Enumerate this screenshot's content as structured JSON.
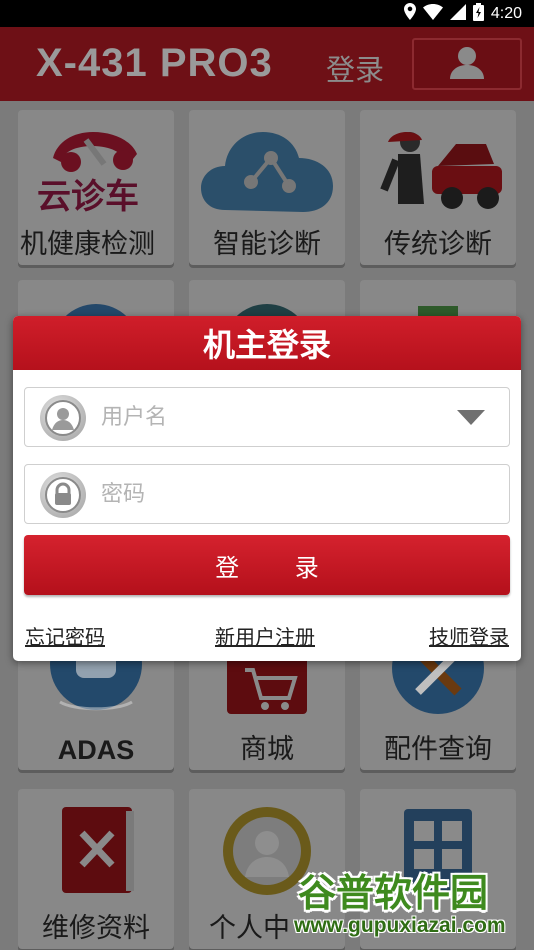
{
  "status_bar": {
    "time": "4:20"
  },
  "app_bar": {
    "title": "X-431 PRO3",
    "login_label": "登录"
  },
  "tiles": [
    {
      "label": "机健康检测",
      "logo_text": "云诊车"
    },
    {
      "label": "智能诊断"
    },
    {
      "label": "传统诊断"
    },
    {
      "label": "ADAS"
    },
    {
      "label": "商城"
    },
    {
      "label": "配件查询"
    },
    {
      "label": "维修资料"
    },
    {
      "label": "个人中"
    },
    {
      "label": ""
    }
  ],
  "dialog": {
    "title": "机主登录",
    "username_placeholder": "用户名",
    "password_placeholder": "密码",
    "login_button": "登 录",
    "forgot_password": "忘记密码",
    "register": "新用户注册",
    "technician_login": "技师登录"
  },
  "watermark": {
    "text": "谷普软件园",
    "url": "www.gupuxiazai.com"
  },
  "colors": {
    "brand_red": "#c8161f",
    "appbar_dimmed": "#6e1016",
    "watermark_green": "#3e8a1e"
  }
}
